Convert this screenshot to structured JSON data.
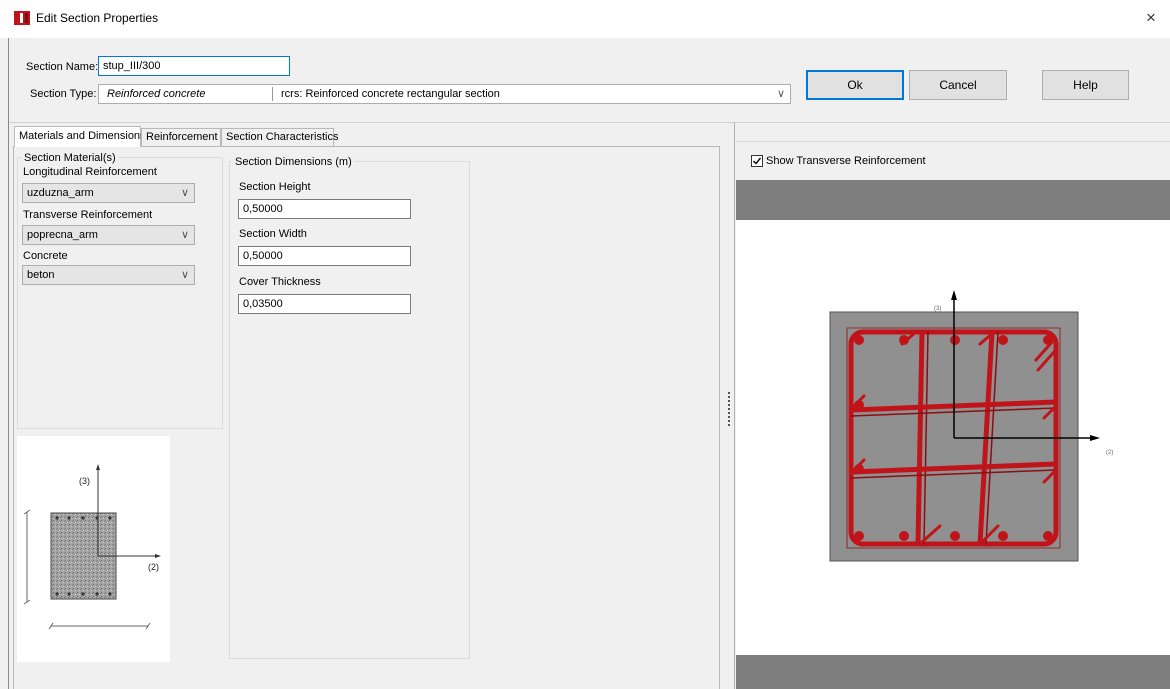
{
  "window": {
    "title": "Edit Section Properties",
    "close_glyph": "×"
  },
  "header": {
    "section_name_label": "Section Name:",
    "section_name_value": "stup_III/300",
    "section_type_label": "Section Type:",
    "section_type_value": "Reinforced concrete",
    "section_type_desc": "rcrs: Reinforced concrete rectangular section",
    "ok_label": "Ok",
    "cancel_label": "Cancel",
    "help_label": "Help"
  },
  "tabs": [
    {
      "label": "Materials and Dimensions",
      "active": true
    },
    {
      "label": "Reinforcement",
      "active": false
    },
    {
      "label": "Section Characteristics",
      "active": false
    }
  ],
  "materials": {
    "group_title": "Section Material(s)",
    "longitudinal_label": "Longitudinal Reinforcement",
    "longitudinal_value": "uzduzna_arm",
    "transverse_label": "Transverse Reinforcement",
    "transverse_value": "poprecna_arm",
    "concrete_label": "Concrete",
    "concrete_value": "beton"
  },
  "dimensions": {
    "group_title": "Section Dimensions (m)",
    "height_label": "Section Height",
    "height_value": "0,50000",
    "width_label": "Section Width",
    "width_value": "0,50000",
    "cover_label": "Cover Thickness",
    "cover_value": "0,03500"
  },
  "small_diagram": {
    "axis3_label": "(3)",
    "axis2_label": "(2)"
  },
  "preview": {
    "show_transverse_label": "Show Transverse Reinforcement",
    "show_transverse_checked": true,
    "axis3_label": "(3)",
    "axis2_label": "(2)"
  },
  "colors": {
    "rebar": "#c0141a",
    "concrete_section": "#909090",
    "preview_band": "#7e7e7e",
    "focus_blue": "#0078d7",
    "app_icon": "#c0141a"
  },
  "icons": {
    "app": "section-properties-app-icon",
    "close": "close-icon",
    "dropdown": "chevron-down-icon",
    "checkbox": "checkbox-checked-icon",
    "splitter": "splitter-grip-icon"
  }
}
